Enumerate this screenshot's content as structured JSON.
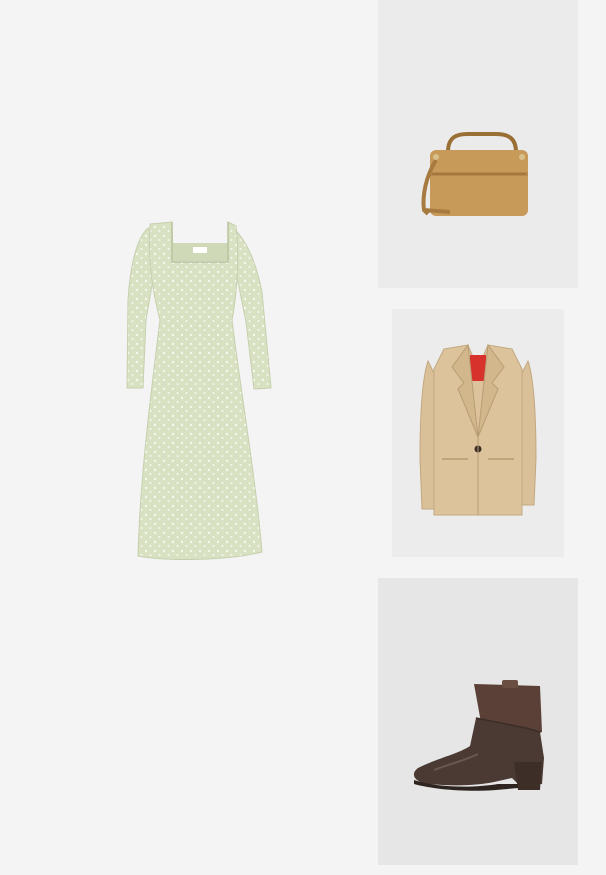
{
  "products": [
    {
      "name": "",
      "category": "dress",
      "icon": "dress-icon",
      "color": "#d9e3c4"
    },
    {
      "name": "",
      "category": "handbag",
      "icon": "handbag-icon",
      "color": "#c89a5a"
    },
    {
      "name": "",
      "category": "blazer",
      "icon": "blazer-icon",
      "color": "#dcc39c"
    },
    {
      "name": "",
      "category": "ankle-boot",
      "icon": "boot-icon",
      "color": "#4a3a33"
    }
  ],
  "colors": {
    "page_background": "#f4f4f4",
    "tile_background": "#ebebeb",
    "blazer_label": "#d8322c"
  }
}
